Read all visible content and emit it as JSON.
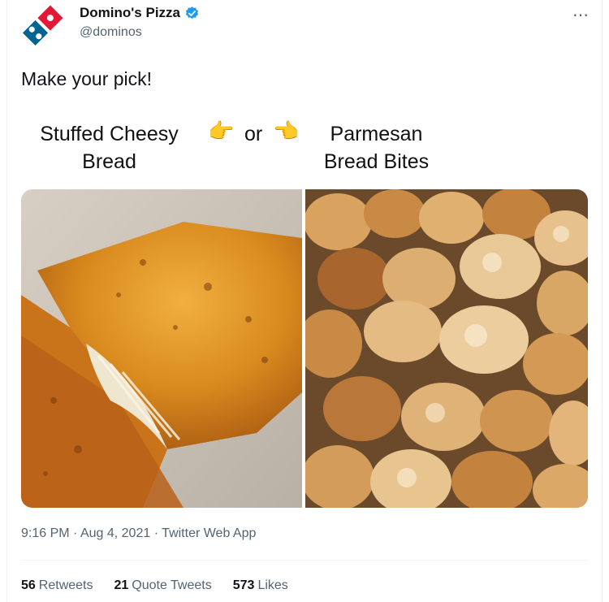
{
  "account": {
    "display_name": "Domino's Pizza",
    "handle": "@dominos",
    "verified": true,
    "avatar_icon": "dominos-logo-icon"
  },
  "more_icon": "⋯",
  "tweet": {
    "text": "Make your pick!",
    "media": {
      "caption_left": "Stuffed Cheesy Bread",
      "or_word": "or",
      "caption_right": "Parmesan Bread Bites",
      "pointer_left_icon": "pointing-right-emoji",
      "pointer_right_icon": "pointing-left-emoji",
      "pointer_left_glyph": "👉",
      "pointer_right_glyph": "👈"
    }
  },
  "meta": {
    "time": "9:16 PM",
    "date": "Aug 4, 2021",
    "source": "Twitter Web App",
    "separator": "·"
  },
  "stats": [
    {
      "count": "56",
      "label": "Retweets"
    },
    {
      "count": "21",
      "label": "Quote Tweets"
    },
    {
      "count": "573",
      "label": "Likes"
    }
  ],
  "colors": {
    "brand_blue": "#006491",
    "brand_red": "#e31837",
    "verified_blue": "#1d9bf0",
    "secondary_text": "#536471"
  }
}
